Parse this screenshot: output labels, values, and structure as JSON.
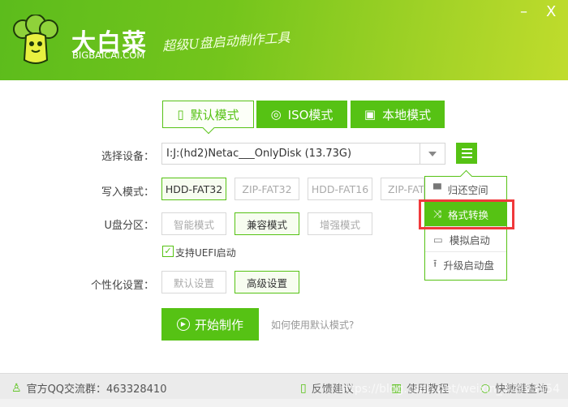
{
  "header": {
    "brand": "大白菜",
    "domain": "BIGBAICAI.COM",
    "slogan": "超级U盘启动制作工具",
    "minimize": "–",
    "close": "X"
  },
  "tabs": [
    {
      "label": "默认模式",
      "icon": "usb-icon"
    },
    {
      "label": "ISO模式",
      "icon": "disc-icon"
    },
    {
      "label": "本地模式",
      "icon": "monitor-icon"
    }
  ],
  "device": {
    "label": "选择设备：",
    "value": "I:J:(hd2)Netac___OnlyDisk (13.73G)"
  },
  "write_mode": {
    "label": "写入模式：",
    "options": [
      "HDD-FAT32",
      "ZIP-FAT32",
      "HDD-FAT16",
      "ZIP-FAT"
    ]
  },
  "partition": {
    "label": "U盘分区：",
    "options": [
      "智能模式",
      "兼容模式",
      "增强模式"
    ]
  },
  "uefi": {
    "label": "支持UEFI启动",
    "checked": true
  },
  "personal": {
    "label": "个性化设置：",
    "options": [
      "默认设置",
      "高级设置"
    ]
  },
  "start_label": "开始制作",
  "help_link": "如何使用默认模式?",
  "menu": [
    {
      "label": "归还空间",
      "icon": "disk-icon"
    },
    {
      "label": "格式转换",
      "icon": "shuffle-icon"
    },
    {
      "label": "模拟启动",
      "icon": "monitor-play-icon"
    },
    {
      "label": "升级启动盘",
      "icon": "upload-icon"
    }
  ],
  "footer": {
    "qq": "官方QQ交流群：463328410",
    "feedback": "反馈建议",
    "tutorial": "使用教程",
    "shortcut": "快捷键查询",
    "watermark": "https://blog.csdn.net/weixin_37993454"
  },
  "colors": {
    "accent": "#56c214",
    "highlight": "#f0393b"
  }
}
